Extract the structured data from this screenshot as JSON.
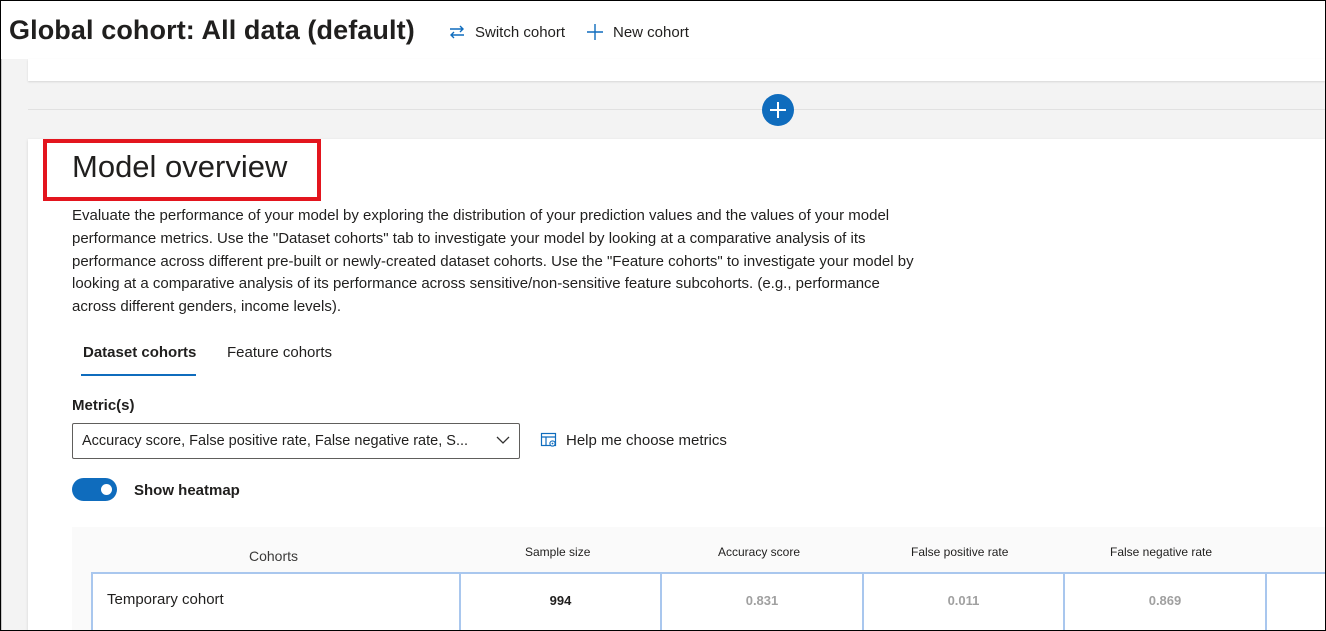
{
  "header": {
    "cohort_title": "Global cohort: All data (default)",
    "switch_cohort_label": "Switch cohort",
    "new_cohort_label": "New cohort"
  },
  "model_overview": {
    "title": "Model overview",
    "description": "Evaluate the performance of your model by exploring the distribution of your prediction values and the values of your model performance metrics. Use the \"Dataset cohorts\" tab to investigate your model by looking at a comparative analysis of its performance across different pre-built or newly-created dataset cohorts. Use the \"Feature cohorts\" to investigate your model by looking at a comparative analysis of its performance across sensitive/non-sensitive feature subcohorts. (e.g., performance across different genders, income levels).",
    "tabs": [
      {
        "label": "Dataset cohorts",
        "selected": true
      },
      {
        "label": "Feature cohorts",
        "selected": false
      }
    ],
    "metric_label": "Metric(s)",
    "metric_value": "Accuracy score, False positive rate, False negative rate, S...",
    "help_label": "Help me choose metrics",
    "heatmap_toggle": {
      "label": "Show heatmap",
      "on": true
    },
    "table": {
      "headers": [
        "Cohorts",
        "Sample size",
        "Accuracy score",
        "False positive rate",
        "False negative rate"
      ],
      "rows": [
        {
          "cohort": "Temporary cohort",
          "sample_size": "994",
          "accuracy": "0.831",
          "fpr": "0.011",
          "fnr": "0.869"
        }
      ]
    }
  },
  "colors": {
    "accent": "#0f6cbd",
    "highlight": "#e3151e",
    "workspace_bg": "#f3f3f3",
    "cell_border": "#a9c7ee"
  },
  "icons": {
    "switch": "switch-arrows-icon",
    "new": "plus-icon",
    "add_section": "add-circle-icon",
    "help": "table-settings-icon",
    "dropdown": "chevron-down-icon"
  }
}
